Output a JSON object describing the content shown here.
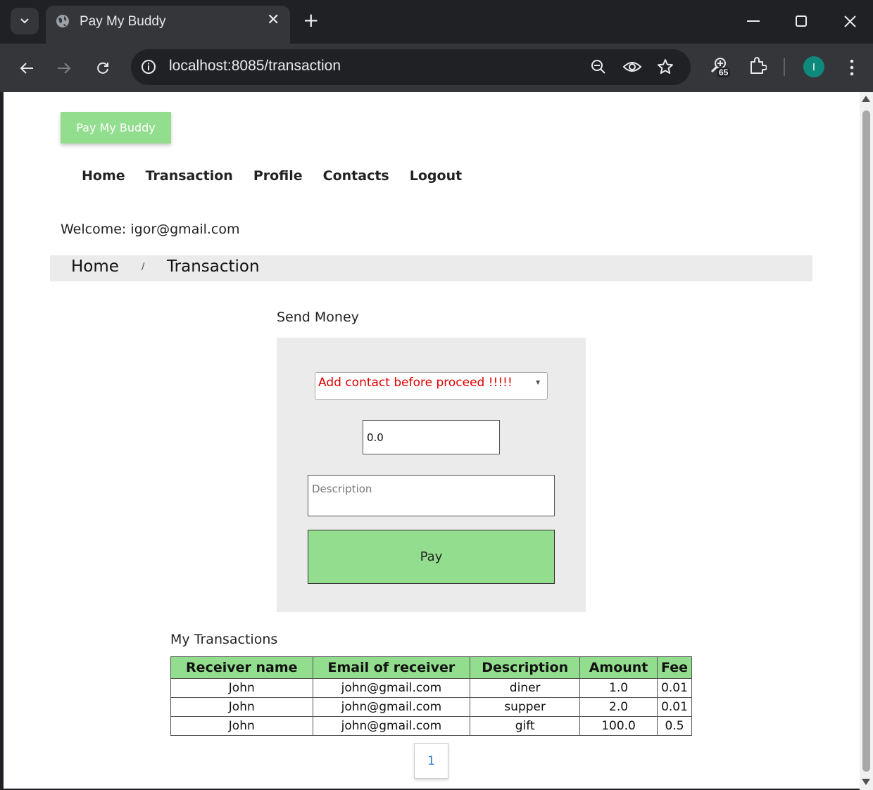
{
  "browser": {
    "tab_title": "Pay My Buddy",
    "tab_close": "✕",
    "new_tab": "+",
    "url": "localhost:8085/transaction",
    "extension_badge": "65",
    "profile_initial": "I"
  },
  "page": {
    "brand": "Pay My Buddy",
    "nav": [
      "Home",
      "Transaction",
      "Profile",
      "Contacts",
      "Logout"
    ],
    "welcome": "Welcome: igor@gmail.com",
    "breadcrumb": {
      "home": "Home",
      "separator": "/",
      "current": "Transaction"
    },
    "send_money": {
      "title": "Send Money",
      "contact_select": "Add contact before proceed !!!!!",
      "amount_value": "0.0",
      "description_placeholder": "Description",
      "pay_label": "Pay"
    },
    "transactions": {
      "title": "My Transactions",
      "columns": [
        "Receiver name",
        "Email of receiver",
        "Description",
        "Amount",
        "Fee"
      ],
      "rows": [
        [
          "John",
          "john@gmail.com",
          "diner",
          "1.0",
          "0.01"
        ],
        [
          "John",
          "john@gmail.com",
          "supper",
          "2.0",
          "0.01"
        ],
        [
          "John",
          "john@gmail.com",
          "gift",
          "100.0",
          "0.5"
        ]
      ]
    },
    "pagination": {
      "current_page": "1"
    }
  },
  "colors": {
    "accent_green": "#93dd8e",
    "error_red": "#e00000",
    "breadcrumb_bg": "#ebebeb",
    "page_link": "#2a7ae2"
  }
}
